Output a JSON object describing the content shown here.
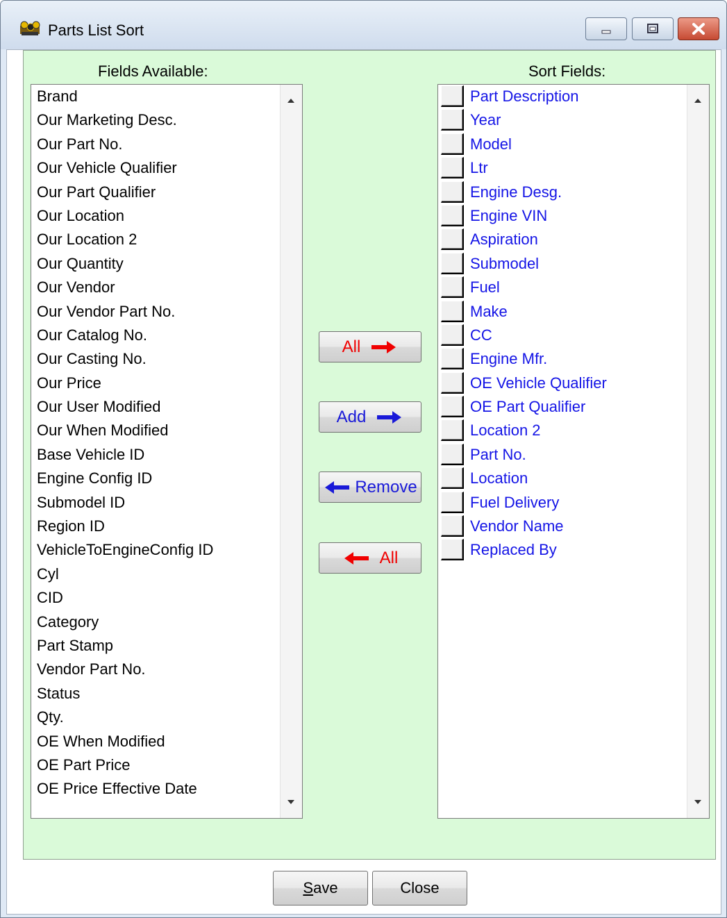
{
  "window": {
    "title": "Parts List Sort"
  },
  "left": {
    "header": "Fields Available:",
    "items": [
      "Brand",
      "Our Marketing Desc.",
      "Our Part No.",
      "Our Vehicle Qualifier",
      "Our Part Qualifier",
      "Our Location",
      "Our Location 2",
      "Our Quantity",
      "Our Vendor",
      "Our Vendor Part No.",
      "Our Catalog No.",
      "Our Casting No.",
      "Our Price",
      "Our User Modified",
      "Our When Modified",
      "Base Vehicle ID",
      "Engine Config ID",
      "Submodel ID",
      "Region ID",
      "VehicleToEngineConfig ID",
      "Cyl",
      "CID",
      "Category",
      "Part Stamp",
      "Vendor Part No.",
      "Status",
      "Qty.",
      "OE When Modified",
      "OE Part Price",
      "OE Price Effective Date"
    ]
  },
  "right": {
    "header": "Sort Fields:",
    "items": [
      "Part Description",
      "Year",
      "Model",
      "Ltr",
      "Engine Desg.",
      "Engine VIN",
      "Aspiration",
      "Submodel",
      "Fuel",
      "Make",
      "CC",
      "Engine Mfr.",
      "OE Vehicle Qualifier",
      "OE Part Qualifier",
      "Location 2",
      "Part No.",
      "Location",
      "Fuel Delivery",
      "Vendor Name",
      "Replaced By"
    ]
  },
  "buttons": {
    "add_all": "All",
    "add": "Add",
    "remove": "Remove",
    "remove_all": "All",
    "save_hotkey": "S",
    "save_rest": "ave",
    "close": "Close"
  },
  "colors": {
    "panel": "#dafad9",
    "sort_text": "#1414e6",
    "red_arrow": "#f00000",
    "blue_arrow": "#1a1ad8"
  }
}
